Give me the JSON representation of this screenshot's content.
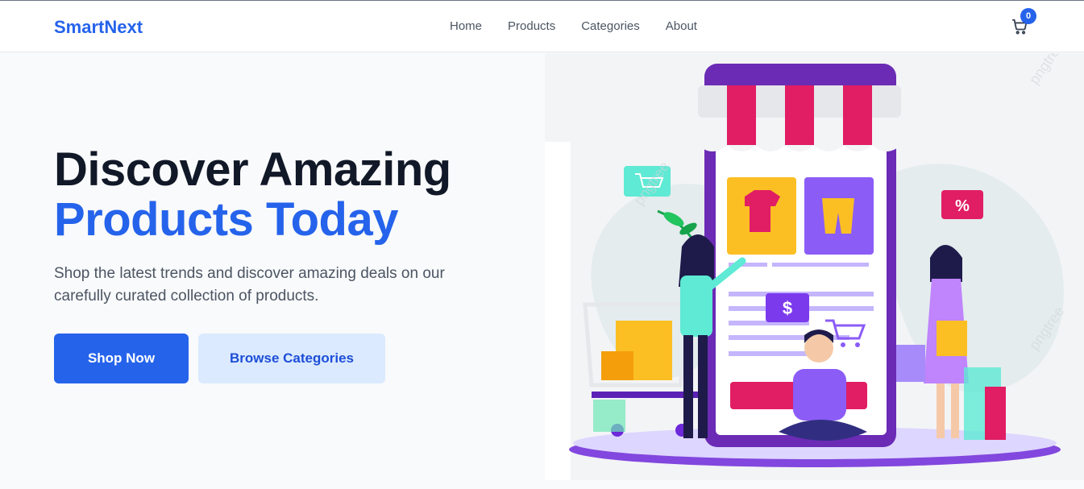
{
  "header": {
    "logo": "SmartNext",
    "nav": [
      "Home",
      "Products",
      "Categories",
      "About"
    ],
    "cart_count": "0",
    "cart_icon": "cart-icon"
  },
  "hero": {
    "title_line1": "Discover Amazing",
    "title_line2": "Products Today",
    "subtitle": "Shop the latest trends and discover amazing deals on our carefully curated collection of products.",
    "primary_button": "Shop Now",
    "secondary_button": "Browse Categories"
  },
  "illustration": {
    "sale_badge": "%",
    "price_tag": "$"
  },
  "colors": {
    "brand": "#2563eb",
    "heading": "#111827",
    "text": "#4b5563",
    "secondary_bg": "#dbeafe"
  }
}
